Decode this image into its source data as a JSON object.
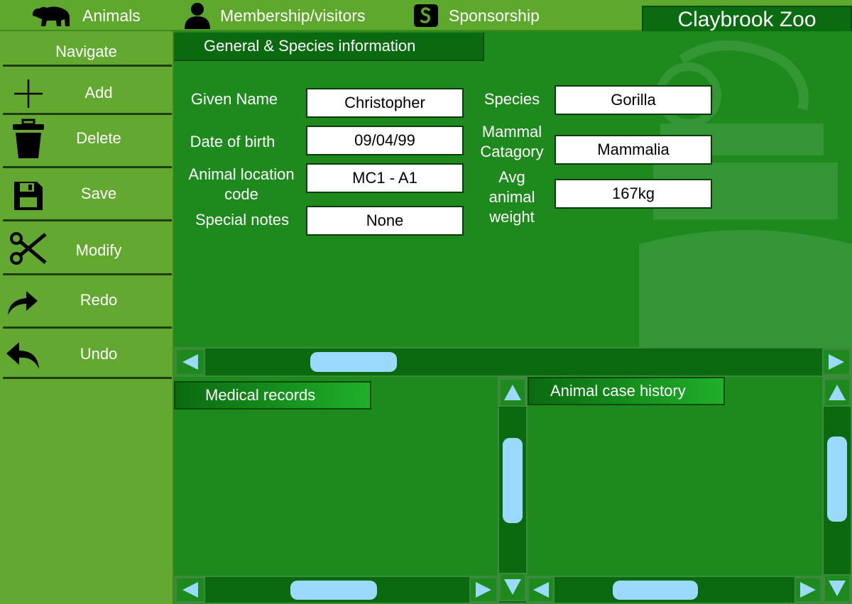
{
  "topbar": {
    "tabs": [
      {
        "label": "Animals",
        "icon": "bear-icon"
      },
      {
        "label": "Membership/visitors",
        "icon": "person-icon"
      },
      {
        "label": "Sponsorship",
        "icon": "sponsor-icon"
      }
    ],
    "brand": "Claybrook Zoo"
  },
  "sidebar": {
    "title": "Navigate",
    "items": [
      {
        "label": "Add",
        "icon": "plus-icon"
      },
      {
        "label": "Delete",
        "icon": "trash-icon"
      },
      {
        "label": "Save",
        "icon": "floppy-disk-icon"
      },
      {
        "label": "Modify",
        "icon": "scissors-icon"
      },
      {
        "label": "Redo",
        "icon": "redo-arrow-icon"
      },
      {
        "label": "Undo",
        "icon": "undo-arrow-icon"
      }
    ]
  },
  "general": {
    "tab_label": "General & Species information",
    "given_name_label": "Given Name",
    "given_name": "Christopher",
    "dob_label": "Date of birth",
    "dob": "09/04/99",
    "location_label_line1": "Animal location",
    "location_label_line2": "code",
    "location": "MC1 - A1",
    "notes_label": "Special notes",
    "notes": "None",
    "species_label": "Species",
    "species": "Gorilla",
    "category_label_line1": "Mammal",
    "category_label_line2": "Catagory",
    "category": "Mammalia",
    "weight_label_line1": "Avg",
    "weight_label_line2": "animal",
    "weight_label_line3": "weight",
    "weight": "167kg"
  },
  "medical": {
    "tab_label": "Medical records"
  },
  "case_history": {
    "tab_label": "Animal case history"
  },
  "colors": {
    "topbar": "#5ea82c",
    "sidebar": "#63a830",
    "panel": "#1e8a1e",
    "tab_dark": "#0b6a10",
    "scroll_thumb": "#9cd9ff"
  }
}
